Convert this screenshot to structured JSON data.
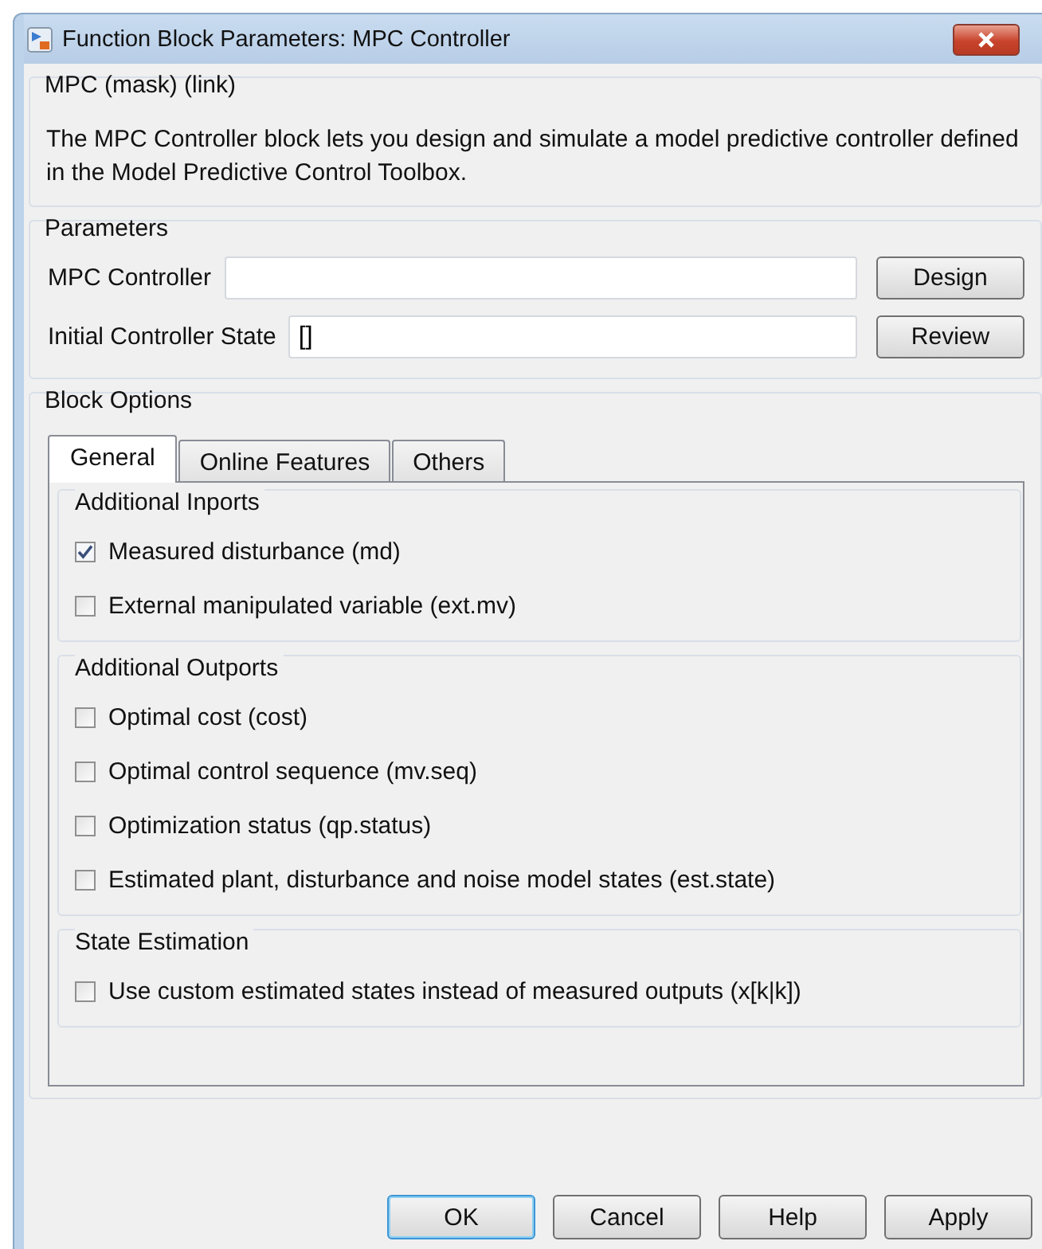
{
  "window": {
    "title": "Function Block Parameters: MPC Controller"
  },
  "mask_group": {
    "title": "MPC (mask) (link)",
    "description": "The MPC Controller block lets you design and simulate a model predictive controller defined in the Model Predictive Control Toolbox."
  },
  "parameters": {
    "title": "Parameters",
    "fields": [
      {
        "label": "MPC Controller",
        "button": "Design"
      },
      {
        "label": "Initial Controller State",
        "value": "[]",
        "button": "Review"
      }
    ]
  },
  "block_options": {
    "title": "Block Options",
    "tabs": [
      {
        "label": "General",
        "selected": true
      },
      {
        "label": "Online Features",
        "selected": false
      },
      {
        "label": "Others",
        "selected": false
      }
    ],
    "sections": [
      {
        "title": "Additional Inports",
        "options": [
          {
            "label": "Measured disturbance (md)",
            "checked": true
          },
          {
            "label": "External manipulated variable (ext.mv)",
            "checked": false
          }
        ]
      },
      {
        "title": "Additional Outports",
        "options": [
          {
            "label": "Optimal cost (cost)",
            "checked": false
          },
          {
            "label": "Optimal control sequence (mv.seq)",
            "checked": false
          },
          {
            "label": "Optimization status (qp.status)",
            "checked": false
          },
          {
            "label": "Estimated plant, disturbance and noise model states (est.state)",
            "checked": false
          }
        ]
      },
      {
        "title": "State Estimation",
        "options": [
          {
            "label": "Use custom estimated states instead of measured outputs (x[k|k])",
            "checked": false
          }
        ]
      }
    ]
  },
  "buttons": [
    {
      "label": "OK",
      "default": true
    },
    {
      "label": "Cancel",
      "default": false
    },
    {
      "label": "Help",
      "default": false
    },
    {
      "label": "Apply",
      "default": false
    }
  ]
}
